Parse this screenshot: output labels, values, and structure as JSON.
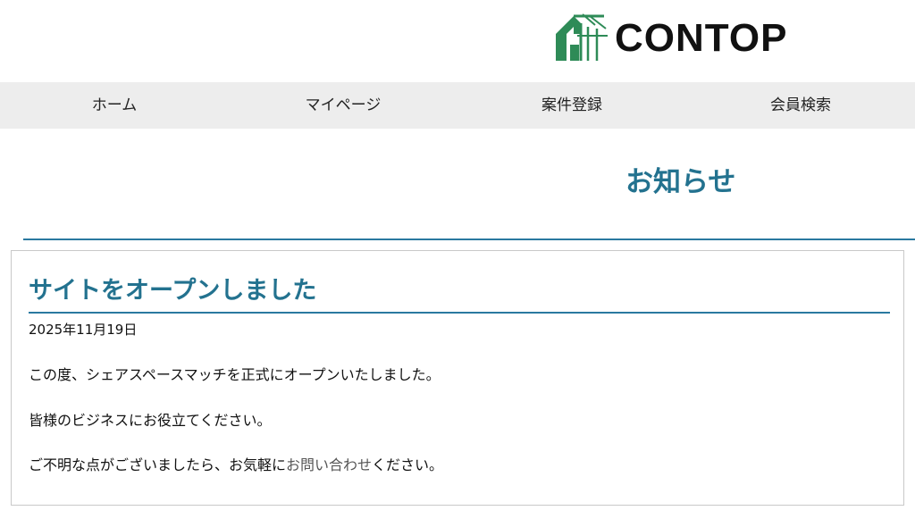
{
  "brand": {
    "name": "CONTOP",
    "logo_icon": "house-icon",
    "logo_color": "#2e8b57"
  },
  "nav": {
    "items": [
      {
        "label": "ホーム"
      },
      {
        "label": "マイページ"
      },
      {
        "label": "案件登録"
      },
      {
        "label": "会員検索"
      }
    ]
  },
  "page": {
    "title": "お知らせ"
  },
  "post": {
    "title": "サイトをオープンしました",
    "date": "2025年11月19日",
    "paragraph1": "この度、シェアスペースマッチを正式にオープンいたしました。",
    "paragraph2": "皆様のビジネスにお役立てください。",
    "paragraph3_before": "ご不明な点がございましたら、お気軽に",
    "contact_link": "お問い合わせ",
    "paragraph3_after": "ください。"
  },
  "colors": {
    "accent": "#23728f",
    "nav_bg": "#ededed"
  }
}
